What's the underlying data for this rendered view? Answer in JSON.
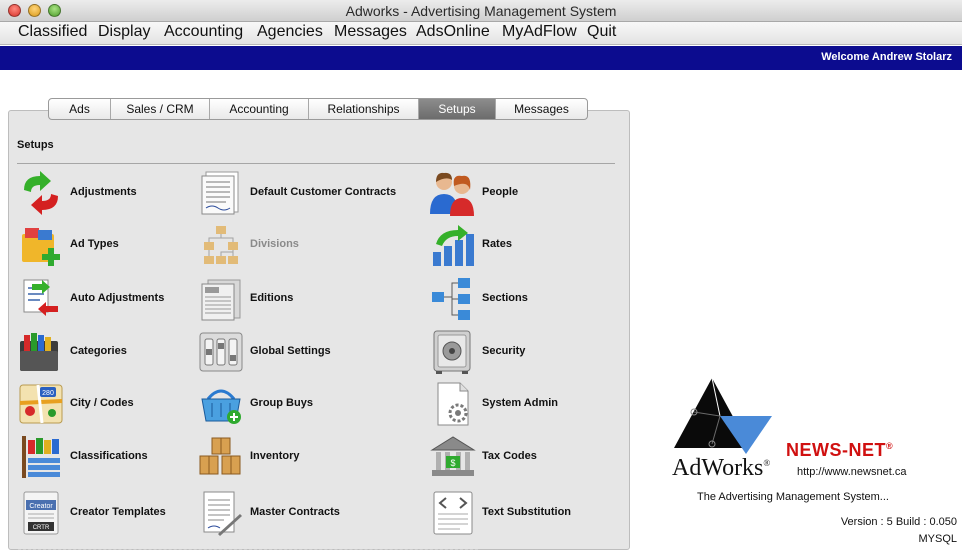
{
  "window": {
    "title": "Adworks - Advertising Management System"
  },
  "menubar": {
    "items": [
      "Classified",
      "Display",
      "Accounting",
      "Agencies",
      "Messages",
      "AdsOnline",
      "MyAdFlow",
      "Quit"
    ]
  },
  "header": {
    "welcome": "Welcome Andrew Stolarz"
  },
  "tabs": [
    {
      "label": "Ads",
      "active": false
    },
    {
      "label": "Sales / CRM",
      "active": false
    },
    {
      "label": "Accounting",
      "active": false
    },
    {
      "label": "Relationships",
      "active": false
    },
    {
      "label": "Setups",
      "active": true
    },
    {
      "label": "Messages",
      "active": false
    }
  ],
  "setups": {
    "title": "Setups",
    "items": [
      {
        "label": "Adjustments",
        "icon": "adjustments-icon",
        "enabled": true
      },
      {
        "label": "Default Customer Contracts",
        "icon": "contract-icon",
        "enabled": true
      },
      {
        "label": "People",
        "icon": "people-icon",
        "enabled": true
      },
      {
        "label": "Ad Types",
        "icon": "ad-types-icon",
        "enabled": true
      },
      {
        "label": "Divisions",
        "icon": "org-chart-icon",
        "enabled": false
      },
      {
        "label": "Rates",
        "icon": "rates-icon",
        "enabled": true
      },
      {
        "label": "Auto Adjustments",
        "icon": "auto-adjustments-icon",
        "enabled": true
      },
      {
        "label": "Editions",
        "icon": "newspaper-icon",
        "enabled": true
      },
      {
        "label": "Sections",
        "icon": "sections-icon",
        "enabled": true
      },
      {
        "label": "Categories",
        "icon": "categories-icon",
        "enabled": true
      },
      {
        "label": "Global Settings",
        "icon": "switches-icon",
        "enabled": true
      },
      {
        "label": "Security",
        "icon": "safe-icon",
        "enabled": true
      },
      {
        "label": "City / Codes",
        "icon": "map-icon",
        "enabled": true
      },
      {
        "label": "Group Buys",
        "icon": "basket-icon",
        "enabled": true
      },
      {
        "label": "System Admin",
        "icon": "system-admin-icon",
        "enabled": true
      },
      {
        "label": "Classifications",
        "icon": "classifications-icon",
        "enabled": true
      },
      {
        "label": "Inventory",
        "icon": "boxes-icon",
        "enabled": true
      },
      {
        "label": "Tax Codes",
        "icon": "bank-icon",
        "enabled": true
      },
      {
        "label": "Creator Templates",
        "icon": "creator-templates-icon",
        "enabled": true
      },
      {
        "label": "Master Contracts",
        "icon": "master-contract-icon",
        "enabled": true
      },
      {
        "label": "Text Substitution",
        "icon": "text-substitution-icon",
        "enabled": true
      }
    ],
    "badges": {
      "map_route": "280",
      "creator_top": "Creator",
      "creator_bottom": "CRTR"
    }
  },
  "branding": {
    "product": "AdWorks",
    "vendor": "NEWS-NET",
    "url": "http://www.newsnet.ca",
    "tagline": "The Advertising Management System...",
    "version": "Version : 5  Build : 0.050",
    "database": "MYSQL"
  },
  "colors": {
    "header_bar": "#0c0c8f",
    "active_tab": "#7a7a7a",
    "vendor_red": "#d01010"
  }
}
